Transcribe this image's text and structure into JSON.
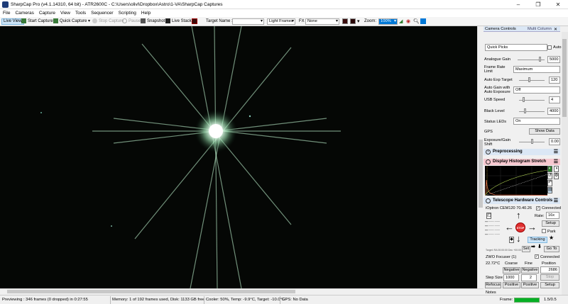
{
  "window": {
    "title": "SharpCap Pro (v4.1.14310, 64 bit) - ATR2600C - C:\\Users\\olivi\\Dropbox\\Astro\\1-VA\\SharpCap Captures",
    "min": "–",
    "max": "❐",
    "close": "✕"
  },
  "menu": [
    "File",
    "Cameras",
    "Capture",
    "View",
    "Tools",
    "Sequencer",
    "Scripting",
    "Help"
  ],
  "toolbar": {
    "live_view": "Live View",
    "start_capture": "Start Capture",
    "quick_capture": "Quick Capture",
    "stop_capture": "Stop Capture",
    "pause": "Pause",
    "snapshot": "Snapshot",
    "live_stack": "Live Stack",
    "target_name_label": "Target Name :",
    "target_name_value": "",
    "frame_type": "Light Frames",
    "fx_label": "FX",
    "fx_value": "None",
    "zoom_label": "Zoom:",
    "zoom_value": "100%"
  },
  "panel": {
    "tabs": {
      "camera_controls": "Camera Controls",
      "multi_column": "Multi Column"
    },
    "quick_picks": "Quick Picks",
    "auto_label": "Auto",
    "analogue_gain": {
      "label": "Analogue Gain",
      "value": "5000",
      "level": 0.85
    },
    "frame_rate_limit": {
      "label1": "Frame Rate",
      "label2": "Limit",
      "value": "Maximum"
    },
    "auto_exp_target": {
      "label": "Auto Exp Target",
      "value": "120",
      "level": 0.4
    },
    "auto_gain_exposure": {
      "label1": "Auto Gain with",
      "label2": "Auto Exposure",
      "value": "Off"
    },
    "usb_speed": {
      "label": "USB Speed",
      "value": "4",
      "level": 0.15
    },
    "black_level": {
      "label": "Black Level",
      "value": "4000",
      "level": 0.2
    },
    "status_leds": {
      "label": "Status LEDs",
      "value": "On"
    },
    "gps": {
      "label": "GPS",
      "button": "Show Data"
    },
    "exp_gain_shift": {
      "label1": "Exposure/Gain",
      "label2": "Shift",
      "value": "0.00",
      "level": 0.5
    },
    "preprocessing": "Preprocessing",
    "histogram_stretch": "Display Histogram Stretch",
    "telescope": "Telescope Hardware Controls",
    "mount": {
      "name": "iOptron CEM120 70.40.26",
      "connected": "Connected",
      "rate_label": "Rate:",
      "rate_value": "16x",
      "setup": "Setup",
      "park": "Park",
      "tracking": "Tracking",
      "stop": "STOP",
      "set": "Set",
      "goto": "Go To",
      "target_text": "Target: RA 00:00:00 Dec +00:00:00"
    },
    "focuser": {
      "name": "ZWO Focuser (1)",
      "connected": "Connected",
      "temp": "22.72°C",
      "coarse": "Coarse",
      "fine": "Fine",
      "position": "Position",
      "neg1": "Negative",
      "neg2": "Negative",
      "pos_value": "2686",
      "step_label": "Step Size",
      "step_value": "1000",
      "fine_value": "2",
      "stop": "Stop",
      "refocus": "Refocus",
      "positive1": "Positive",
      "positive2": "Positive",
      "setup": "Setup"
    },
    "notes": "Notes"
  },
  "status": {
    "previewing": "Previewing : 346 frames (0 dropped) in 0:27:55",
    "memory": "Memory: 1 of 192 frames used, Disk: 1133 GB free",
    "cooler": "Cooler: 50%, Temp: -9.9°C, Target: -10.0°C",
    "gps": "GPS: No Data",
    "frame_label": "Frame:",
    "fps": "1.5/0.5",
    "frame_progress": 0.9
  },
  "colors": {
    "accent": "#0078d7",
    "tracking": "#cce4f7",
    "hist_header": "#f7c8d0",
    "stop": "#e03030"
  }
}
